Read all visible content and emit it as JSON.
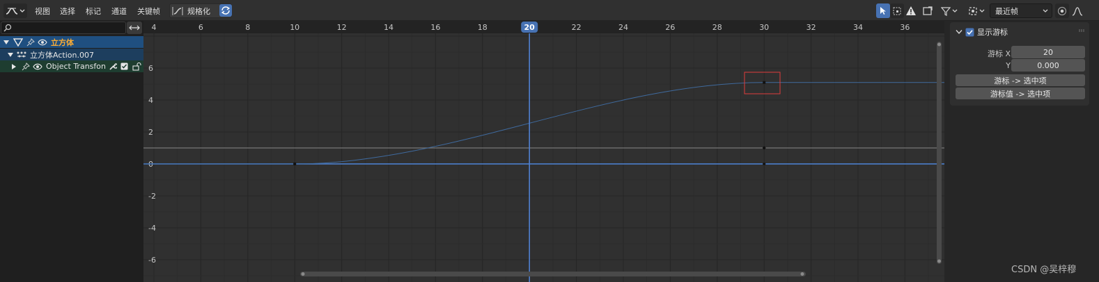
{
  "header": {
    "editor_icon": "graph-editor-icon",
    "menus": [
      "视图",
      "选择",
      "标记",
      "通道",
      "关键帧"
    ],
    "normalize_label": "规格化",
    "interp_dropdown_value": "最近帧"
  },
  "channels": {
    "search_placeholder": "",
    "object_name": "立方体",
    "action_name": "立方体Action.007",
    "fcurve_group": "Object Transfon"
  },
  "graph": {
    "current_frame": "20",
    "x_ticks": [
      "4",
      "6",
      "8",
      "10",
      "12",
      "14",
      "16",
      "18",
      "20",
      "22",
      "24",
      "26",
      "28",
      "30",
      "32",
      "34",
      "36"
    ],
    "y_ticks": [
      "6",
      "4",
      "2",
      "0",
      "-2",
      "-4",
      "-6"
    ],
    "curve_keyframes": [
      {
        "frame": 10,
        "value": 0
      },
      {
        "frame": 30,
        "value": 5.1
      }
    ],
    "cursor_value": 1
  },
  "sidebar": {
    "panel_title": "显示游标",
    "show_cursor_checked": true,
    "cursor_x_label": "游标 X",
    "cursor_x_value": "20",
    "cursor_y_label": "Y",
    "cursor_y_value": "0.000",
    "btn_cursor_to_selected": "游标 -> 选中项",
    "btn_cursor_value_to_selected": "游标值 -> 选中项"
  },
  "colors": {
    "accent": "#4772b3",
    "graph_bg": "#303030",
    "curve": "#4f7ab8",
    "selection_box": "#e03c3c"
  },
  "watermark": "CSDN @吴梓穆"
}
